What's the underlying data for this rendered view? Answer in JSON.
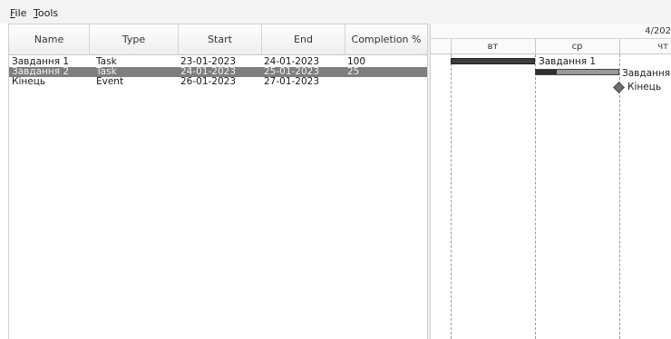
{
  "menu": {
    "file_underlined": "F",
    "file_rest": "ile",
    "tools_underlined": "T",
    "tools_rest": "ools"
  },
  "table": {
    "columns": [
      "Name",
      "Type",
      "Start",
      "End",
      "Completion %"
    ],
    "rows": [
      {
        "name": "Завдання 1",
        "type": "Task",
        "start": "23-01-2023",
        "end": "24-01-2023",
        "completion": "100",
        "selected": false
      },
      {
        "name": "Завдання 2",
        "type": "Task",
        "start": "24-01-2023",
        "end": "25-01-2023",
        "completion": "25",
        "selected": true
      },
      {
        "name": "Кінець",
        "type": "Event",
        "start": "26-01-2023",
        "end": "27-01-2023",
        "completion": "",
        "selected": false
      }
    ]
  },
  "gantt": {
    "header_date": "4/202",
    "days": [
      "вт",
      "ср",
      "чт"
    ],
    "bar_labels": [
      "Завдання 1",
      "Завдання",
      "Кінець"
    ]
  },
  "colors": {
    "selected_row": "#7e7e7e",
    "bar_dark": "#3d3d3d",
    "milestone": "#6f6f6f"
  }
}
